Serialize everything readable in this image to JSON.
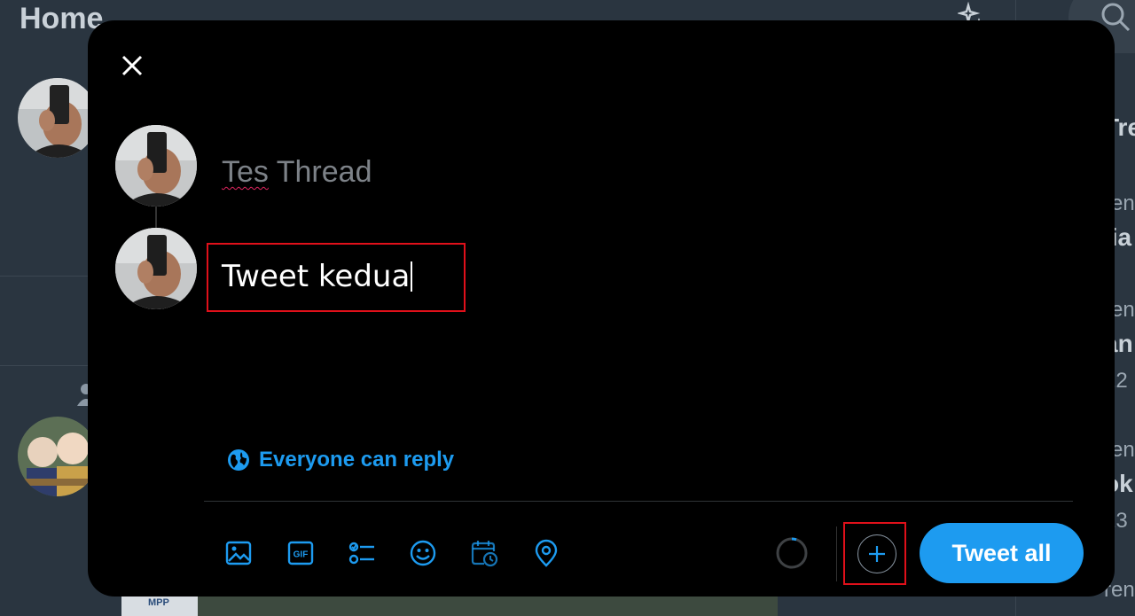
{
  "background": {
    "page_title": "Home",
    "trends": [
      {
        "text": "Tre",
        "bold": true
      },
      {
        "text": "ren",
        "bold": false
      },
      {
        "text": "lia",
        "bold": true
      },
      {
        "text": "ren",
        "bold": false
      },
      {
        "text": "an",
        "bold": true
      },
      {
        "text": "22",
        "bold": false
      },
      {
        "text": "ren",
        "bold": false
      },
      {
        "text": "ok",
        "bold": true
      },
      {
        "text": "23",
        "bold": false
      },
      {
        "text": "ren",
        "bold": false
      }
    ],
    "image_caption": "MPP"
  },
  "composer": {
    "close_icon": "close-icon",
    "tweets": [
      {
        "text_part1": "Tes",
        "text_part2": " Thread"
      },
      {
        "text": "Tweet kedua"
      }
    ],
    "reply_setting": "Everyone can reply",
    "toolbar_icons": [
      "image-icon",
      "gif-icon",
      "poll-icon",
      "emoji-icon",
      "schedule-icon",
      "location-icon"
    ],
    "gif_label": "GIF",
    "tweet_all_label": "Tweet all"
  },
  "colors": {
    "accent": "#1d9bf0",
    "highlight_box": "#e0101a",
    "modal_bg": "#000000"
  }
}
